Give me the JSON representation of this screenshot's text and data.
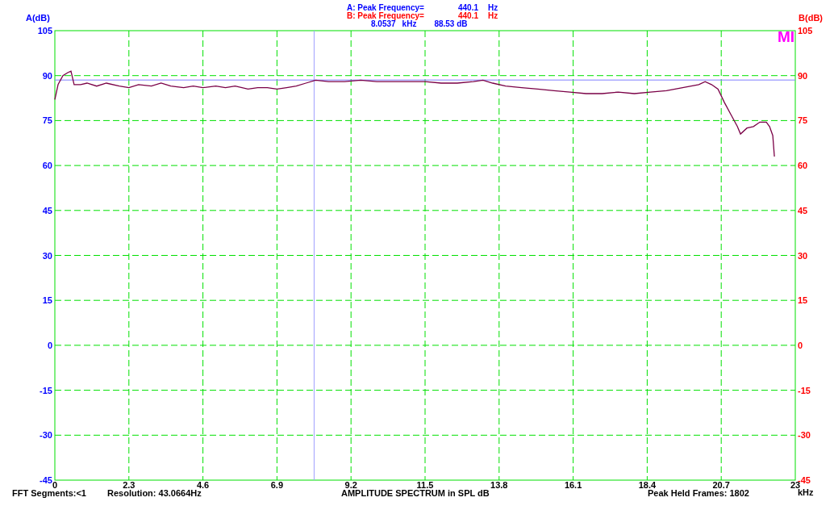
{
  "header": {
    "right_axis_label": "B(dB)",
    "peaks": [
      {
        "label": "A: Peak Frequency=",
        "value": "440.1",
        "unit": "Hz",
        "color": "#0000ff"
      },
      {
        "label": "B: Peak Frequency=",
        "value": "440.1",
        "unit": "Hz",
        "color": "#ff0000"
      }
    ],
    "cursor_reading": {
      "x_value": "8.0537",
      "x_unit": "kHz",
      "y_value": "88.53 dB"
    }
  },
  "logo": "MI",
  "chart": {
    "right_yticks": [
      "105",
      "90",
      "75",
      "60",
      "45",
      "30",
      "15",
      "0",
      "-15",
      "-30",
      "-45"
    ],
    "chart_data": {
      "type": "line",
      "title": "AMPLITUDE SPECTRUM in SPL dB",
      "xlabel": "kHz",
      "ylabel": "A(dB)",
      "xlim": [
        0,
        23
      ],
      "ylim": [
        -45,
        105
      ],
      "xticks": [
        0,
        2.3,
        4.6,
        6.9,
        9.2,
        11.5,
        13.8,
        16.1,
        18.4,
        20.7,
        23
      ],
      "yticks": [
        105,
        90,
        75,
        60,
        45,
        30,
        15,
        0,
        -15,
        -30,
        -45
      ],
      "x": [
        0,
        0.1,
        0.25,
        0.4,
        0.5,
        0.6,
        0.8,
        1.0,
        1.3,
        1.6,
        2.0,
        2.3,
        2.6,
        3.0,
        3.3,
        3.6,
        4.0,
        4.3,
        4.6,
        5.0,
        5.3,
        5.6,
        6.0,
        6.3,
        6.6,
        6.9,
        7.2,
        7.5,
        7.8,
        8.1,
        8.5,
        9.0,
        9.5,
        10.0,
        10.5,
        11.0,
        11.5,
        12.0,
        12.5,
        13.0,
        13.3,
        13.6,
        14.0,
        14.5,
        15.0,
        15.5,
        16.0,
        16.5,
        17.0,
        17.5,
        18.0,
        18.5,
        19.0,
        19.5,
        20.0,
        20.2,
        20.4,
        20.6,
        20.8,
        21.0,
        21.2,
        21.3,
        21.5,
        21.7,
        21.9,
        22.1,
        22.2,
        22.3,
        22.35
      ],
      "series": [
        {
          "color": "#7a0046",
          "values": [
            82,
            87,
            90,
            91,
            91.5,
            87,
            87,
            87.5,
            86.5,
            87.5,
            86.5,
            86,
            87,
            86.5,
            87.5,
            86.5,
            86,
            86.5,
            86,
            86.5,
            86,
            86.5,
            85.5,
            86,
            86,
            85.5,
            86,
            86.5,
            87.5,
            88.5,
            88,
            88,
            88.5,
            88,
            88,
            88,
            88,
            87.5,
            87.5,
            88,
            88.5,
            87.5,
            86.5,
            86,
            85.5,
            85,
            84.5,
            84,
            84,
            84.5,
            84,
            84.5,
            85,
            86,
            87,
            88,
            87,
            85.5,
            81,
            77,
            73,
            70.5,
            72.5,
            73,
            74.5,
            74.5,
            73,
            70,
            63
          ]
        }
      ],
      "grid": true,
      "ref_lines": [
        {
          "axis": "x",
          "value": 8.0537,
          "color": "#a0a0ff"
        },
        {
          "axis": "y",
          "value": 88.53,
          "color": "#8080ff"
        }
      ]
    }
  },
  "footer": {
    "fft_segments": "FFT Segments:<1",
    "resolution": "Resolution: 43.0664Hz",
    "peak_held_frames": "Peak Held Frames: 1802"
  }
}
